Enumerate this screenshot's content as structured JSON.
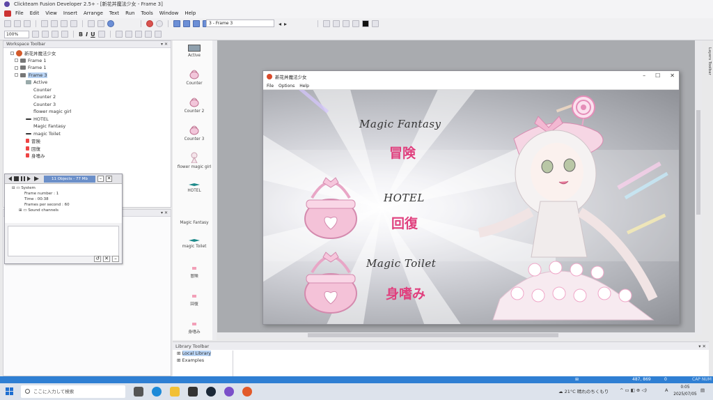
{
  "titlebar": {
    "title": "Clickteam Fusion Developer 2.5+ - [新花丼魔法少女 - Frame 3]"
  },
  "menu": [
    "File",
    "Edit",
    "View",
    "Insert",
    "Arrange",
    "Text",
    "Run",
    "Tools",
    "Window",
    "Help"
  ],
  "toolbar": {
    "zoom": "100%",
    "frame_select": "3 - Frame 3",
    "bold": "B",
    "italic": "I",
    "underline": "U"
  },
  "workspace": {
    "title": "Workspace Toolbar",
    "root": "新花丼魔法少女",
    "frames": [
      "Frame 1",
      "Frame 1",
      "Frame 3"
    ],
    "objects": [
      "Active",
      "Counter",
      "Counter 2",
      "Counter 3",
      "flower magic girl",
      "HOTEL",
      "Magic Fantasy",
      "magic Toilet",
      "冒険",
      "回復",
      "身嗜み"
    ]
  },
  "debugger": {
    "status": "11 Objects - 77 Mb",
    "system": "System",
    "frame_number": "Frame number : 1",
    "time": "Time : 00:38",
    "fps": "Frames per second : 60",
    "sound": "Sound channels"
  },
  "palette": [
    "Active",
    "Counter",
    "Counter 2",
    "Counter 3",
    "flower magic girl",
    "HOTEL",
    "Magic Fantasy",
    "magic Toilet",
    "冒険",
    "回復",
    "身嗜み"
  ],
  "game": {
    "title": "新花丼魔法少女",
    "menu": [
      "File",
      "Options",
      "Help"
    ],
    "magic_fantasy": "Magic Fantasy",
    "adventure": "冒険",
    "hotel": "HOTEL",
    "recover": "回復",
    "magic_toilet": "Magic Toilet",
    "groom": "身嗜み"
  },
  "layers": {
    "label": "Layers Toolbar"
  },
  "library": {
    "title": "Library Toolbar",
    "items": [
      "Local Library",
      "Examples"
    ]
  },
  "status": {
    "coords": "487, 869",
    "zero": "0",
    "cap": "CAP NUM"
  },
  "taskbar": {
    "search_placeholder": "ここに入力して検索",
    "weather": "21°C 晴れのちくもり",
    "time": "0:05",
    "date": "2025/07/05",
    "ime": "A"
  },
  "colors": {
    "accent": "#2f7fd3",
    "jp_text": "#e0407e",
    "selection": "#b9d4f5"
  }
}
